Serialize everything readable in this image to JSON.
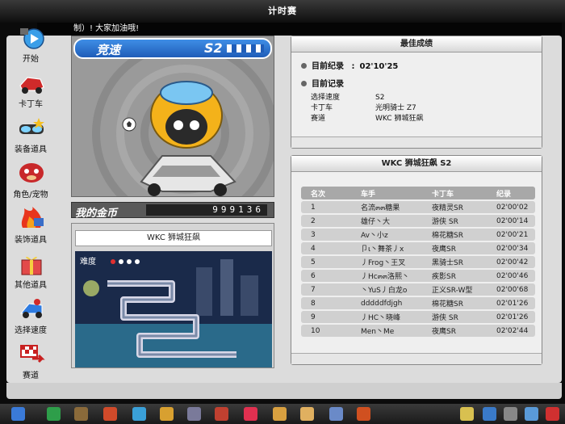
{
  "window": {
    "title": "计时赛"
  },
  "ticker": {
    "text": "制）! 大家加油哦!"
  },
  "sidebar": {
    "items": [
      {
        "label": "开始",
        "icon": "start-icon"
      },
      {
        "label": "卡丁车",
        "icon": "kart-icon"
      },
      {
        "label": "装备道具",
        "icon": "goggles-icon"
      },
      {
        "label": "角色/宠物",
        "icon": "character-icon"
      },
      {
        "label": "装饰道具",
        "icon": "flame-hat-icon"
      },
      {
        "label": "其他道具",
        "icon": "gift-box-icon"
      },
      {
        "label": "选择速度",
        "icon": "speed-kart-icon"
      },
      {
        "label": "赛道",
        "icon": "track-flag-icon"
      }
    ]
  },
  "preview": {
    "mode": "竞速",
    "season": "S2"
  },
  "coins": {
    "label": "我的金币",
    "value": "999136"
  },
  "track": {
    "name": "WKC 狮城狂飙",
    "difficulty_label": "难度",
    "difficulty_level": 1,
    "difficulty_max": 5
  },
  "best": {
    "header": "最佳成绩",
    "current_record_label": "目前纪录",
    "current_record_value": "02'10'25",
    "record_label": "目前记录",
    "details": [
      {
        "key": "选择速度",
        "value": "S2"
      },
      {
        "key": "卡丁车",
        "value": "光明骑士 Z7"
      },
      {
        "key": "赛道",
        "value": "WKC 狮城狂飙"
      }
    ]
  },
  "ranking": {
    "header": "WKC 狮城狂飙 S2",
    "columns": [
      "名次",
      "车手",
      "卡丁车",
      "纪录"
    ],
    "rows": [
      [
        "1",
        "名流๓๓糖果",
        "夜精灵SR",
        "02'00'02"
      ],
      [
        "2",
        "雄仔丶大",
        "游侠 SR",
        "02'00'14"
      ],
      [
        "3",
        "Av丶小z",
        "棉花糖SR",
        "02'00'21"
      ],
      [
        "4",
        "卩ι丶舞茶丿x",
        "夜鹰SR",
        "02'00'34"
      ],
      [
        "5",
        "丿Frog丶王叉",
        "黑骑士SR",
        "02'00'42"
      ],
      [
        "6",
        "丿Hc๓๓洛熙丶",
        "疾影SR",
        "02'00'46"
      ],
      [
        "7",
        "丶YuS丿白龙o",
        "正义SR-W型",
        "02'00'68"
      ],
      [
        "8",
        "dddddfdjgh",
        "棉花糖SR",
        "02'01'26"
      ],
      [
        "9",
        "丿HC丶晓峰",
        "游侠 SR",
        "02'01'26"
      ],
      [
        "10",
        "Men丶Me",
        "夜鹰SR",
        "02'02'44"
      ]
    ]
  },
  "taskbar": {
    "icons": [
      "start-logo-icon",
      "back-icon",
      "shop-cart-icon",
      "character-icon",
      "pet-icon",
      "kart-icon",
      "settings-gear-icon",
      "mail-icon",
      "heart-icon",
      "tools-icon",
      "hand-icon",
      "book-icon",
      "helmet-icon",
      "notes-icon",
      "community-icon",
      "wrench-icon",
      "search-icon",
      "power-icon"
    ]
  },
  "colors": {
    "accent_blue": "#1f5db8",
    "record_red": "#e03030"
  }
}
